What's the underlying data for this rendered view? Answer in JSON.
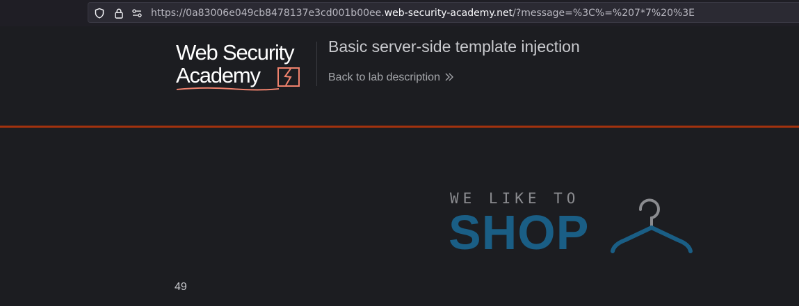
{
  "browser": {
    "url_prefix": "https://0a83006e049cb8478137e3cd001b00ee.",
    "url_domain": "web-security-academy.net",
    "url_suffix": "/?message=%3C%=%207*7%20%3E"
  },
  "lab_header": {
    "logo_line1": "Web Security",
    "logo_line2": "Academy",
    "title": "Basic server-side template injection",
    "back_link": "Back to lab description"
  },
  "shop": {
    "tagline": "WE LIKE TO",
    "word": "SHOP"
  },
  "result": {
    "value": "49"
  },
  "colors": {
    "accent_rule": "#a3320e",
    "shop_blue": "#1a5e85",
    "logo_accent": "#f0826d"
  }
}
